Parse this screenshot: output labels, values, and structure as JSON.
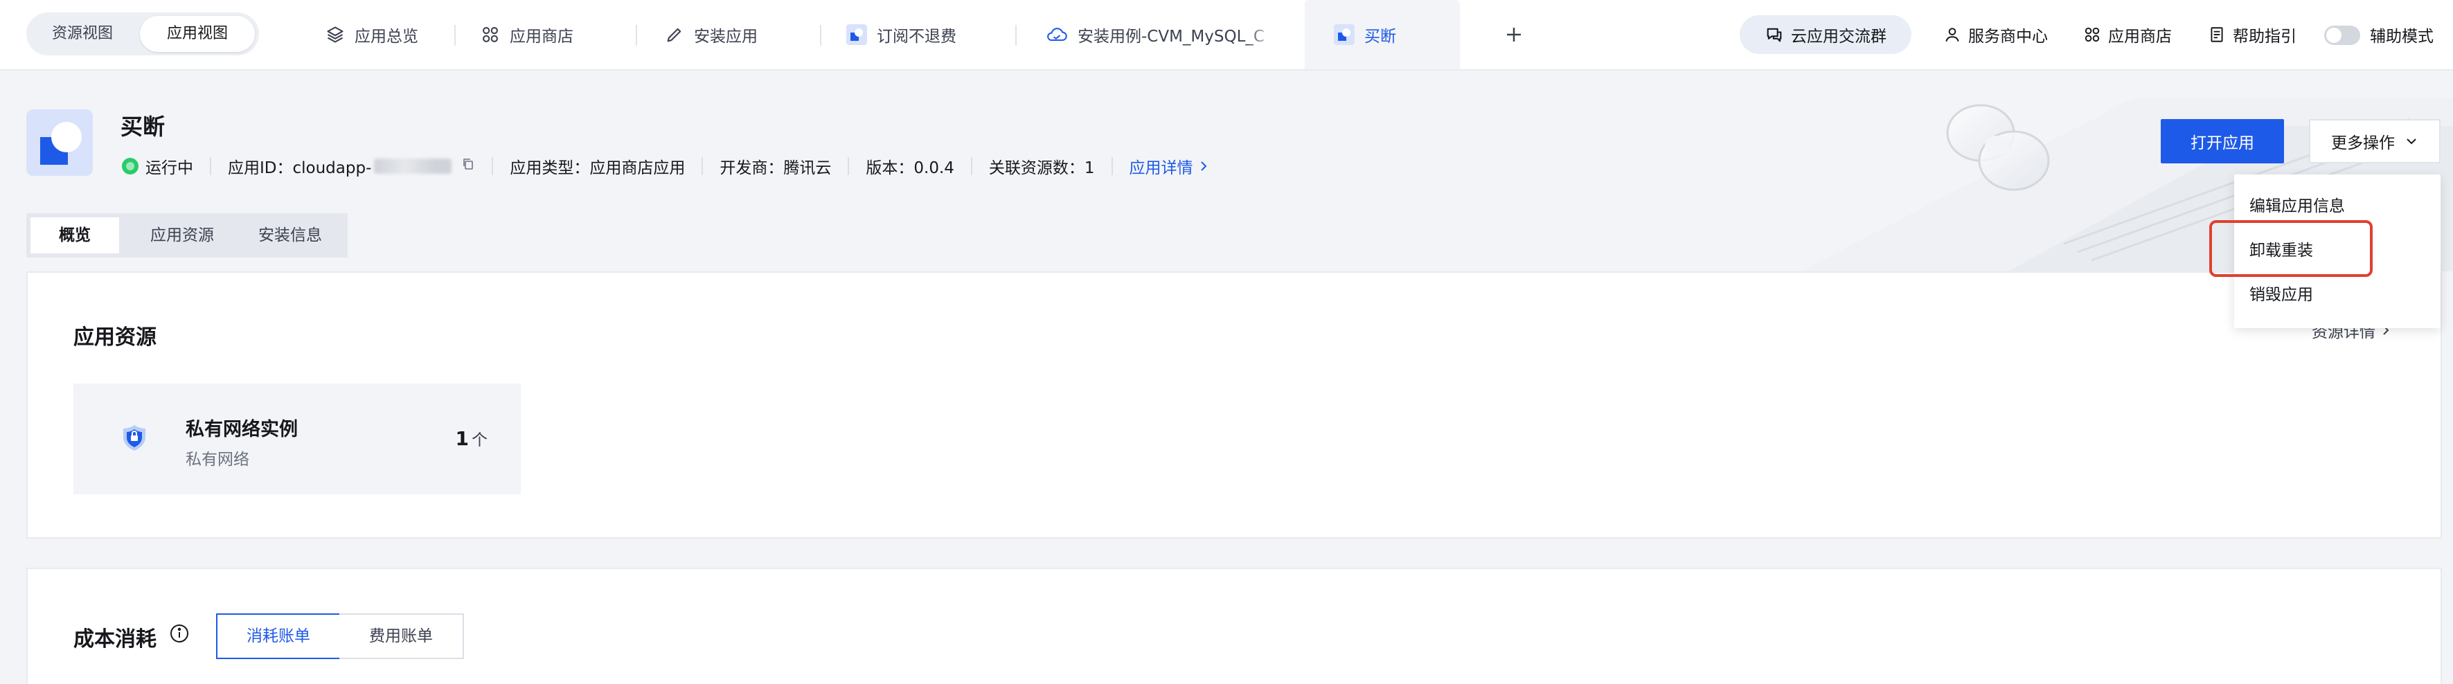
{
  "topbar": {
    "view_switch": [
      "资源视图",
      "应用视图"
    ],
    "tabs": [
      {
        "label": "应用总览",
        "icon": "layers-icon"
      },
      {
        "label": "应用商店",
        "icon": "grid-icon"
      },
      {
        "label": "安装应用",
        "icon": "pencil-icon"
      },
      {
        "label": "订阅不退费",
        "icon": "app-logo-icon"
      },
      {
        "label": "安装用例-CVM_MySQL_C",
        "icon": "cloud-icon"
      },
      {
        "label": "买断",
        "icon": "app-logo-icon"
      }
    ],
    "community": "云应用交流群",
    "links": {
      "service_center": "服务商中心",
      "app_store": "应用商店",
      "help": "帮助指引",
      "assist_mode": "辅助模式"
    }
  },
  "app": {
    "name": "买断",
    "status": "运行中",
    "id_label": "应用ID：cloudapp-",
    "type": "应用类型：应用商店应用",
    "developer": "开发商：腾讯云",
    "version": "版本：0.0.4",
    "related": "关联资源数：1",
    "detail_link": "应用详情"
  },
  "actions": {
    "open": "打开应用",
    "more": "更多操作",
    "menu": [
      "编辑应用信息",
      "卸载重装",
      "销毁应用"
    ],
    "highlighted": "卸载重装"
  },
  "subtabs": [
    "概览",
    "应用资源",
    "安装信息"
  ],
  "resources": {
    "title": "应用资源",
    "detail_link": "资源详情",
    "items": [
      {
        "name": "私有网络实例",
        "type": "私有网络",
        "count": "1",
        "unit": "个"
      }
    ]
  },
  "cost": {
    "title": "成本消耗",
    "tabs": [
      "消耗账单",
      "费用账单"
    ]
  },
  "colors": {
    "primary": "#1e5ae8",
    "running": "#29cc6a",
    "highlight_border": "#e0402f"
  }
}
